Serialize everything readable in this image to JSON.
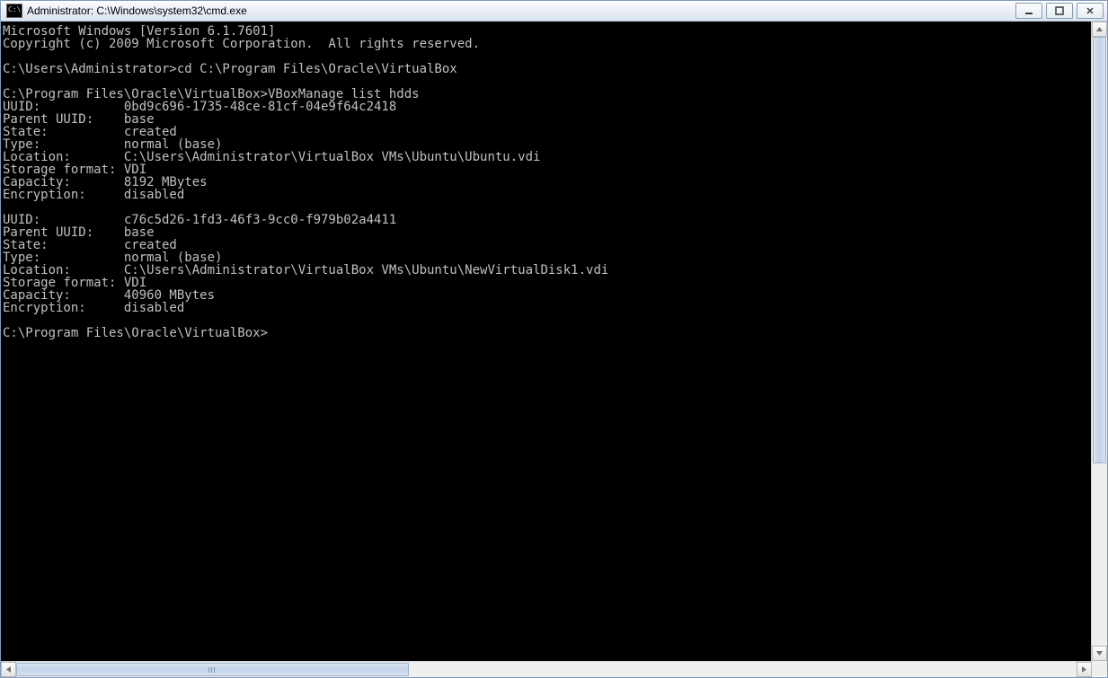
{
  "window": {
    "title": "Administrator: C:\\Windows\\system32\\cmd.exe"
  },
  "terminal": {
    "lines": [
      "Microsoft Windows [Version 6.1.7601]",
      "Copyright (c) 2009 Microsoft Corporation.  All rights reserved.",
      "",
      "C:\\Users\\Administrator>cd C:\\Program Files\\Oracle\\VirtualBox",
      "",
      "C:\\Program Files\\Oracle\\VirtualBox>VBoxManage list hdds",
      "UUID:           0bd9c696-1735-48ce-81cf-04e9f64c2418",
      "Parent UUID:    base",
      "State:          created",
      "Type:           normal (base)",
      "Location:       C:\\Users\\Administrator\\VirtualBox VMs\\Ubuntu\\Ubuntu.vdi",
      "Storage format: VDI",
      "Capacity:       8192 MBytes",
      "Encryption:     disabled",
      "",
      "UUID:           c76c5d26-1fd3-46f3-9cc0-f979b02a4411",
      "Parent UUID:    base",
      "State:          created",
      "Type:           normal (base)",
      "Location:       C:\\Users\\Administrator\\VirtualBox VMs\\Ubuntu\\NewVirtualDisk1.vdi",
      "Storage format: VDI",
      "Capacity:       40960 MBytes",
      "Encryption:     disabled",
      "",
      "C:\\Program Files\\Oracle\\VirtualBox>"
    ]
  }
}
